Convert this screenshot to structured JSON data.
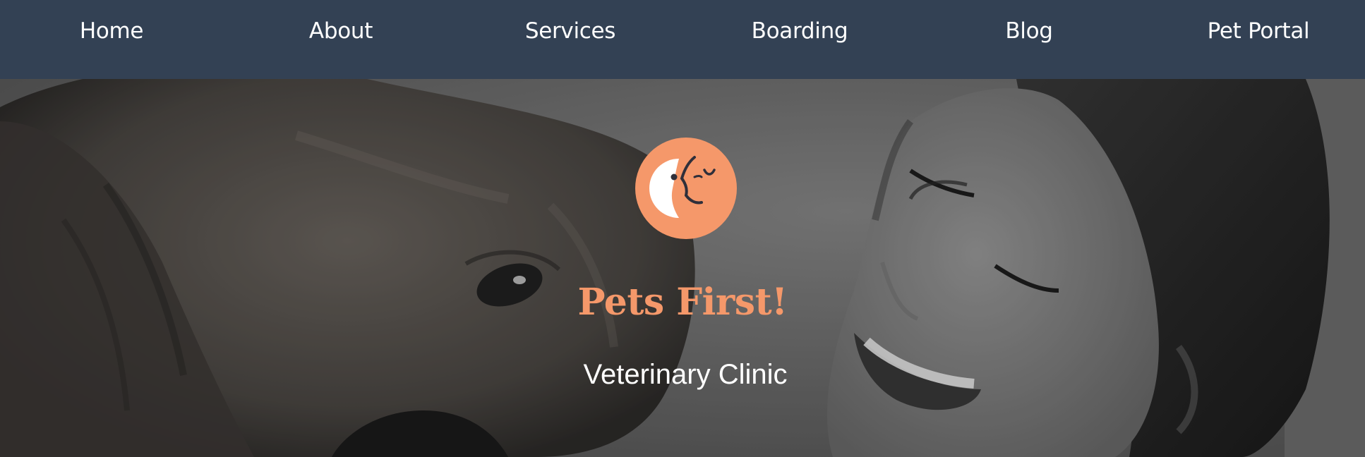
{
  "nav": {
    "items": [
      {
        "label": "Home"
      },
      {
        "label": "About"
      },
      {
        "label": "Services"
      },
      {
        "label": "Boarding"
      },
      {
        "label": "Blog"
      },
      {
        "label": "Pet Portal"
      }
    ]
  },
  "hero": {
    "logo_icon": "pet-and-human-face-icon",
    "brand_name": "Pets First!",
    "tagline": "Veterinary Clinic"
  },
  "colors": {
    "nav_background": "#334154",
    "accent": "#f5986a",
    "text_light": "#ffffff"
  }
}
